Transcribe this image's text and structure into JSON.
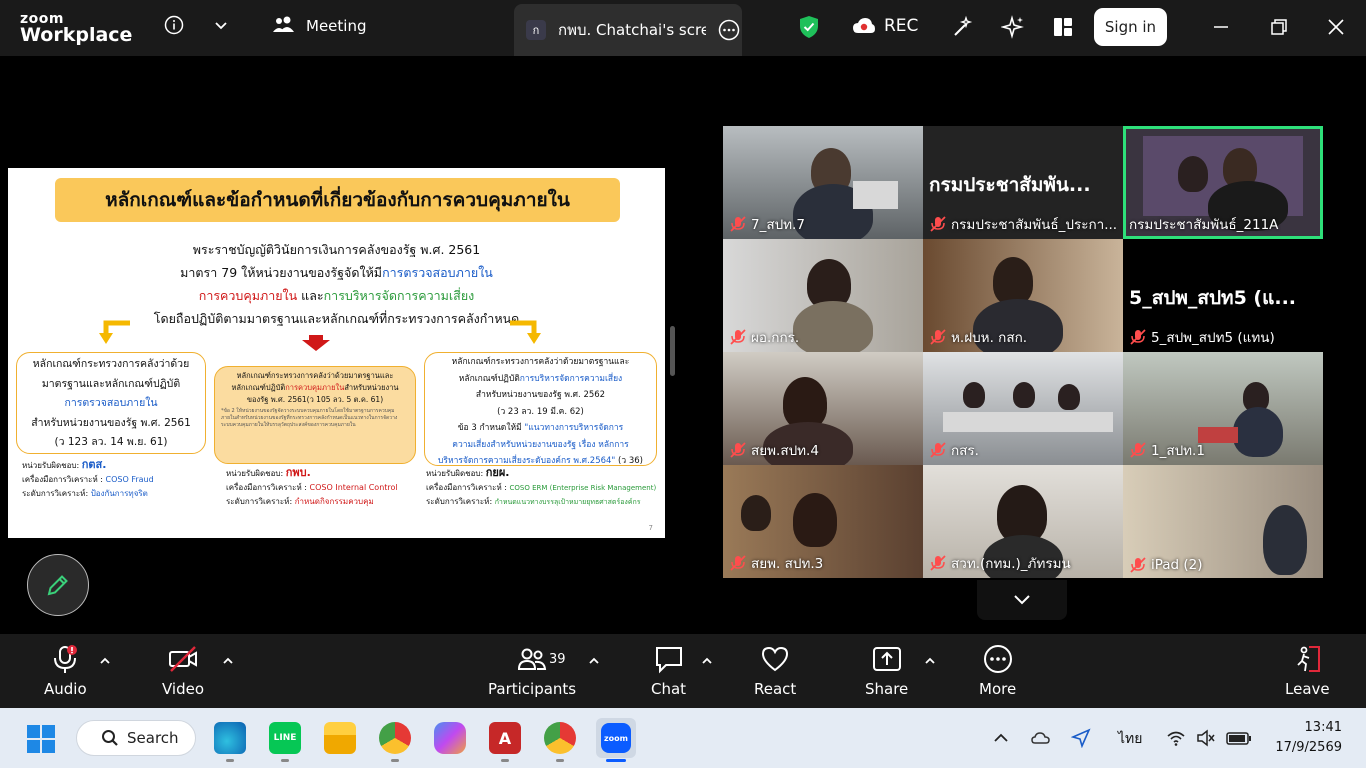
{
  "topbar": {
    "logo_line1": "zoom",
    "logo_line2": "Workplace",
    "meeting_label": "Meeting",
    "share_badge": "ก",
    "share_title": "กพบ. Chatchai's screen",
    "rec_label": "REC",
    "signin_label": "Sign in"
  },
  "slide": {
    "title": "หลักเกณฑ์และข้อกำหนดที่เกี่ยวข้องกับการควบคุมภายใน",
    "line1": "พระราชบัญญัติวินัยการเงินการคลังของรัฐ พ.ศ. 2561",
    "line2_a": "มาตรา 79 ให้หน่วยงานของรัฐจัดให้มี",
    "line2_b": "การตรวจสอบภายใน",
    "line3_a": "การควบคุมภายใน",
    "line3_b": " และ",
    "line3_c": "การบริหารจัดการความเสี่ยง",
    "line4": "โดยถือปฏิบัติตามมาตรฐานและหลักเกณฑ์ที่กระทรวงการคลังกำหนด",
    "box1": {
      "l1": "หลักเกณฑ์กระทรวงการคลังว่าด้วย",
      "l2": "มาตรฐานและหลักเกณฑ์ปฏิบัติ",
      "l3": "การตรวจสอบภายใน",
      "l4": "สำหรับหน่วยงานของรัฐ พ.ศ. 2561",
      "l5": "(ว 123 ลว. 14 พ.ย. 61)"
    },
    "box2": {
      "l1": "หลักเกณฑ์กระทรวงการคลังว่าด้วยมาตรฐานและ",
      "l2a": "หลักเกณฑ์ปฏิบัติ",
      "l2b": "การควบคุมภายใน",
      "l2c": "สำหรับหน่วยงาน",
      "l3": "ของรัฐ พ.ศ. 2561(ว 105 ลว. 5 ต.ค. 61)",
      "small": "*ข้อ 2 ให้หน่วยงานของรัฐจัดวางระบบควบคุมภายในโดยใช้มาตรฐานการควบคุมภายในสำหรับหน่วยงานของรัฐที่กระทรวงการคลังกำหนดเป็นแนวทางในการจัดวางระบบควบคุมภายในให้บรรลุวัตถุประสงค์ของการควบคุมภายใน"
    },
    "box3": {
      "l1": "หลักเกณฑ์กระทรวงการคลังว่าด้วยมาตรฐานและ",
      "l2a": "หลักเกณฑ์ปฏิบัติ",
      "l2b": "การบริหารจัดการความเสี่ยง",
      "l3": "สำหรับหน่วยงานของรัฐ พ.ศ. 2562",
      "l4": "(ว 23 ลว. 19 มี.ค. 62)",
      "l5a": "ข้อ 3 กำหนดให้มี ",
      "l5b": "\"แนวทางการบริหารจัดการ",
      "l6": "ความเสี่ยงสำหรับหน่วยงานของรัฐ เรื่อง หลักการ",
      "l7": "บริหารจัดการความเสี่ยงระดับองค์กร พ.ศ.2564\"",
      "l7b": " (ว 36)"
    },
    "resp1": {
      "owner_label": "หน่วยรับผิดชอบ: ",
      "owner": "กตส.",
      "tool_label": "เครื่องมือการวิเคราะห์ : ",
      "tool": "COSO Fraud",
      "level_label": "ระดับการวิเคราะห์: ",
      "level": "ป้องกันการทุจริต"
    },
    "resp2": {
      "owner_label": "หน่วยรับผิดชอบ: ",
      "owner": "กพบ.",
      "tool_label": "เครื่องมือการวิเคราะห์ : ",
      "tool": "COSO Internal Control",
      "level_label": "ระดับการวิเคราะห์: ",
      "level": "กำหนดกิจกรรมควบคุม"
    },
    "resp3": {
      "owner_label": "หน่วยรับผิดชอบ: ",
      "owner": "กยผ.",
      "tool_label": "เครื่องมือการวิเคราะห์ : ",
      "tool": "COSO ERM (Enterprise Risk Management)",
      "level_label": "ระดับการวิเคราะห์: ",
      "level": "กำหนดแนวทางบรรลุเป้าหมายยุทธศาสตร์องค์กร"
    },
    "page": "7"
  },
  "participants": [
    {
      "name": "7_สปท.7",
      "big": ""
    },
    {
      "name": "กรมประชาสัมพันธ์_ประกา...",
      "big": "กรมประชาสัมพัน..."
    },
    {
      "name": "กรมประชาสัมพันธ์_211A",
      "big": ""
    },
    {
      "name": "ผอ.กกร.",
      "big": ""
    },
    {
      "name": "ห.ฝบห. กสก.",
      "big": ""
    },
    {
      "name": "5_สปพ_สปท5 (แทน)",
      "big": "5_สปพ_สปท5 (แ..."
    },
    {
      "name": "สยพ.สปท.4",
      "big": ""
    },
    {
      "name": "กสร.",
      "big": ""
    },
    {
      "name": "1_สปท.1",
      "big": ""
    },
    {
      "name": "สยพ. สปท.3",
      "big": ""
    },
    {
      "name": "สวท.(กทม.)_ภัทรมน",
      "big": ""
    },
    {
      "name": "iPad (2)",
      "big": ""
    }
  ],
  "toolbar": {
    "audio": "Audio",
    "video": "Video",
    "participants": "Participants",
    "participants_count": "39",
    "chat": "Chat",
    "react": "React",
    "share": "Share",
    "more": "More",
    "leave": "Leave"
  },
  "taskbar": {
    "search_label": "Search",
    "lang": "ไทย",
    "time": "13:41",
    "date": "17/9/2569"
  },
  "colors": {
    "accent_green": "#2ee07a",
    "rec_red": "#ff4d4d",
    "slide_banner": "#fac85a",
    "slide_blue": "#1a5cc8",
    "slide_red": "#d01818"
  }
}
